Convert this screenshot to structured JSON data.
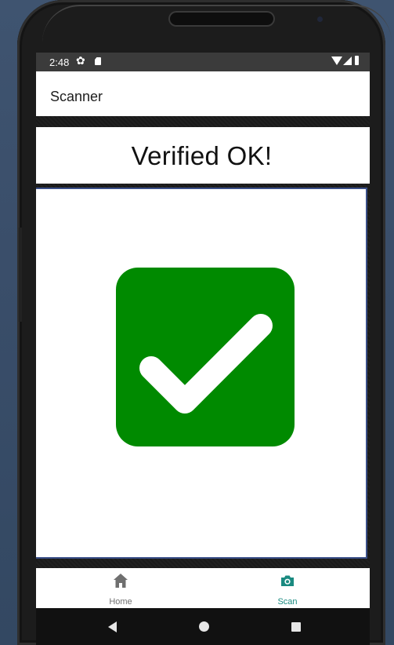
{
  "status_bar": {
    "time": "2:48",
    "icons": [
      "gear-icon",
      "sd-card-icon",
      "wifi-icon",
      "signal-icon",
      "battery-icon"
    ]
  },
  "app_bar": {
    "title": "Scanner"
  },
  "result": {
    "message": "Verified OK!",
    "icon": "check-box-icon",
    "icon_color": "#008a00"
  },
  "bottom_nav": {
    "items": [
      {
        "label": "Home",
        "icon": "home-icon",
        "selected": false
      },
      {
        "label": "Scan",
        "icon": "camera-icon",
        "selected": true
      }
    ],
    "accent_color": "#1a8a80"
  },
  "system_nav": {
    "buttons": [
      "back-button",
      "home-button",
      "recents-button"
    ]
  }
}
